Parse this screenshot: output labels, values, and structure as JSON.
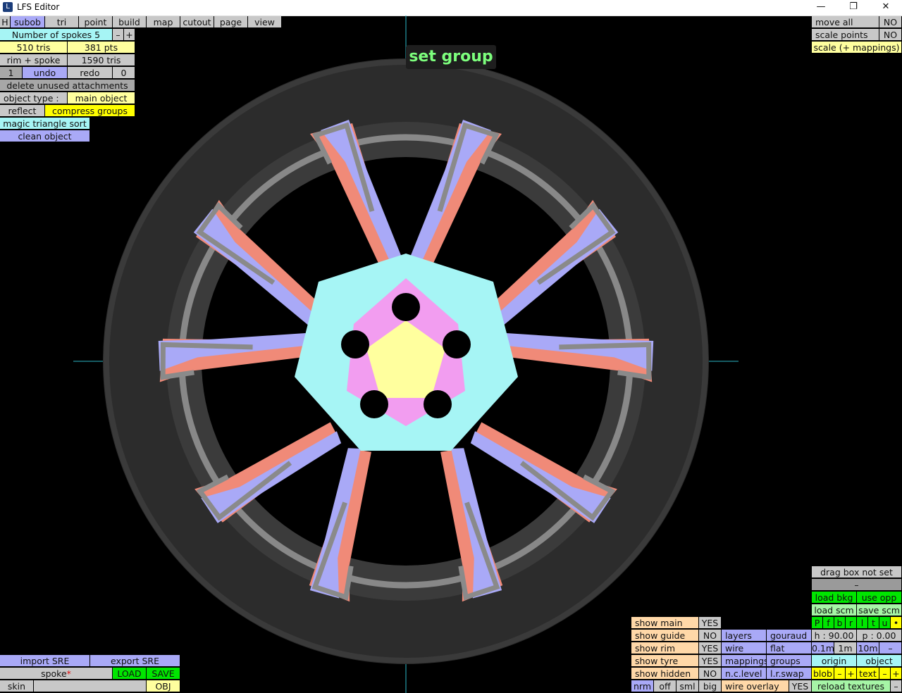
{
  "window": {
    "title": "LFS Editor",
    "icon": "lfs-icon"
  },
  "menu": {
    "items": [
      "H",
      "subob",
      "tri",
      "point",
      "build",
      "map",
      "cutout",
      "page",
      "view"
    ]
  },
  "left_panel": {
    "spokes_label": "Number of spokes 5",
    "minus": "–",
    "plus": "+",
    "tris": "510 tris",
    "pts": "381 pts",
    "rim_spoke": "rim + spoke",
    "total_tris": "1590 tris",
    "undo_count": "1",
    "undo": "undo",
    "redo": "redo",
    "redo_count": "0",
    "delete_unused": "delete unused attachments",
    "object_type_label": "object type :",
    "object_type_value": "main object",
    "reflect": "reflect",
    "compress_groups": "compress groups",
    "magic_sort": "magic triangle sort",
    "clean_object": "clean object"
  },
  "top_right": {
    "move_all": "move all",
    "move_all_val": "NO",
    "scale_points": "scale points",
    "scale_points_val": "NO",
    "scale_mappings": "scale (+ mappings)"
  },
  "viewport": {
    "status": "set group"
  },
  "bottom_left": {
    "import_sre": "import SRE",
    "export_sre": "export SRE",
    "spoke": "spoke",
    "spoke_mark": "*",
    "load": "LOAD",
    "save": "SAVE",
    "skin": "skin",
    "obj": "OBJ"
  },
  "bottom_right": {
    "drag_box": "drag box not set",
    "dash": "–",
    "load_bkg": "load bkg",
    "use_opp": "use opp",
    "load_scm": "load scm",
    "save_scm": "save scm",
    "letters": [
      "P",
      "f",
      "b",
      "r",
      "l",
      "t",
      "u",
      "•"
    ],
    "h_val": "h : 90.00",
    "p_val": "p : 0.00",
    "scale_01": "0.1m",
    "scale_1": "1m",
    "scale_10": "10m",
    "scale_minus": "–",
    "origin": "origin",
    "object": "object",
    "blob": "blob",
    "text": "text",
    "small_minus": "–",
    "small_plus": "+",
    "reload_textures": "reload textures",
    "end_minus": "–",
    "rows": [
      {
        "label": "show main",
        "val": "YES"
      },
      {
        "label": "show guide",
        "val": "NO"
      },
      {
        "label": "show rim",
        "val": "YES"
      },
      {
        "label": "show tyre",
        "val": "YES"
      },
      {
        "label": "show hidden",
        "val": "NO"
      }
    ],
    "layers": "layers",
    "gouraud": "gouraud",
    "wire": "wire",
    "flat": "flat",
    "mappings": "mappings",
    "groups": "groups",
    "nc_level": "n.c.level",
    "lr_swap": "l.r.swap",
    "nrm": "nrm",
    "off": "off",
    "sml": "sml",
    "big": "big",
    "wire_overlay": "wire overlay",
    "wire_overlay_val": "YES"
  }
}
